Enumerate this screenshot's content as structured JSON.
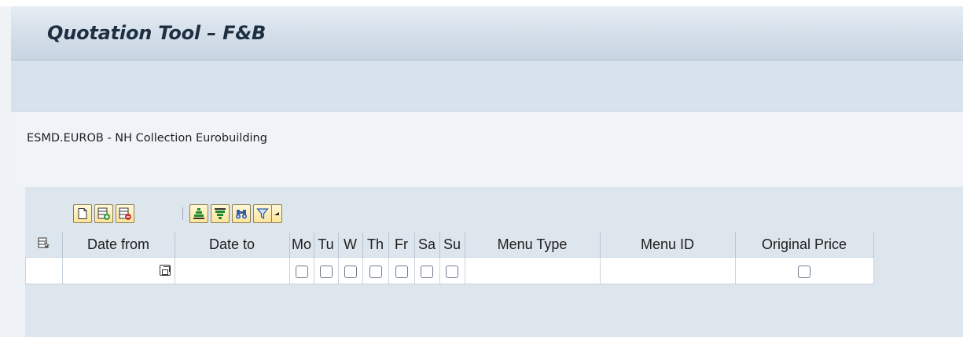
{
  "title": "Quotation Tool – F&B",
  "hotel_label": "ESMD.EUROB - NH Collection Eurobuilding",
  "toolbar": {
    "buttons": [
      {
        "name": "new-row-button",
        "icon": "new-document-icon"
      },
      {
        "name": "insert-row-button",
        "icon": "insert-row-icon"
      },
      {
        "name": "delete-row-button",
        "icon": "delete-row-icon"
      },
      {
        "name": "sort-ascending-button",
        "icon": "sort-ascending-icon"
      },
      {
        "name": "sort-descending-button",
        "icon": "sort-descending-icon"
      },
      {
        "name": "find-button",
        "icon": "binoculars-icon"
      },
      {
        "name": "filter-button",
        "icon": "filter-icon"
      },
      {
        "name": "filter-dropdown-button",
        "icon": "dropdown-arrow-icon"
      }
    ]
  },
  "table": {
    "columns": {
      "date_from": "Date from",
      "date_to": "Date to",
      "mo": "Mo",
      "tu": "Tu",
      "w": "W",
      "th": "Th",
      "fr": "Fr",
      "sa": "Sa",
      "su": "Su",
      "menu_type": "Menu Type",
      "menu_id": "Menu ID",
      "original_price": "Original Price"
    },
    "rows": [
      {
        "date_from": "",
        "date_to": "",
        "mo": false,
        "tu": false,
        "w": false,
        "th": false,
        "fr": false,
        "sa": false,
        "su": false,
        "menu_type": "",
        "menu_id": "",
        "original_price": false
      }
    ]
  },
  "colors": {
    "title_bar": "#d3dee9",
    "input_focus": "#fbdf8f",
    "toolbar_button": "#fde49a"
  }
}
